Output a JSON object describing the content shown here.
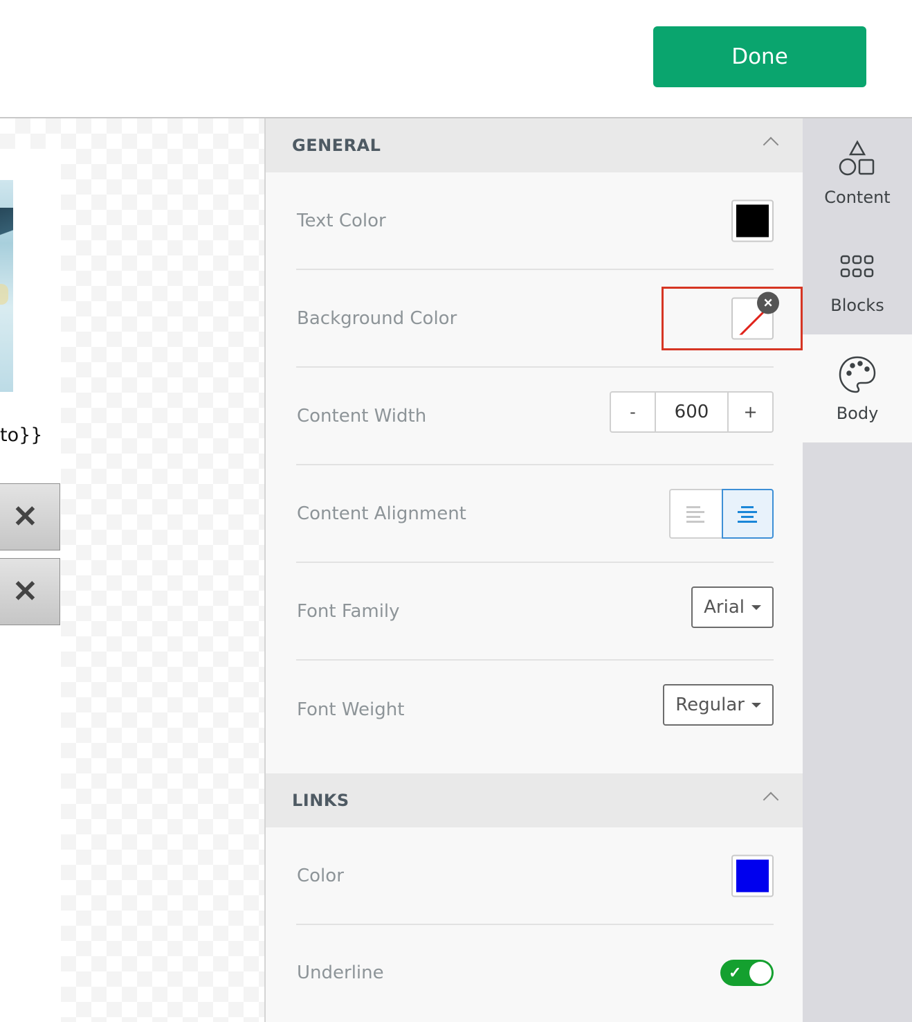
{
  "header": {
    "done_label": "Done"
  },
  "canvas": {
    "merge_tag_text": "to}}",
    "remove_glyph": "✕"
  },
  "sections": {
    "general": {
      "title": "GENERAL",
      "rows": {
        "text_color": {
          "label": "Text Color",
          "value": "#000000"
        },
        "background_color": {
          "label": "Background Color",
          "value": "transparent",
          "clear_glyph": "×"
        },
        "content_width": {
          "label": "Content Width",
          "value": "600",
          "minus": "-",
          "plus": "+"
        },
        "content_alignment": {
          "label": "Content Alignment",
          "options": [
            "left",
            "center"
          ],
          "selected": "center"
        },
        "font_family": {
          "label": "Font Family",
          "value": "Arial"
        },
        "font_weight": {
          "label": "Font Weight",
          "value": "Regular"
        }
      }
    },
    "links": {
      "title": "LINKS",
      "rows": {
        "color": {
          "label": "Color",
          "value": "#0000ee"
        },
        "underline": {
          "label": "Underline",
          "enabled": true
        }
      }
    }
  },
  "rail": {
    "tabs": [
      {
        "label": "Content",
        "icon": "shapes-icon"
      },
      {
        "label": "Blocks",
        "icon": "grid-icon"
      },
      {
        "label": "Body",
        "icon": "palette-icon",
        "active": true
      }
    ]
  },
  "colors": {
    "done_button": "#0aa56e",
    "highlight_box": "#d63523",
    "toggle_on": "#14a02f",
    "alignment_active": "#3d8fd6"
  }
}
